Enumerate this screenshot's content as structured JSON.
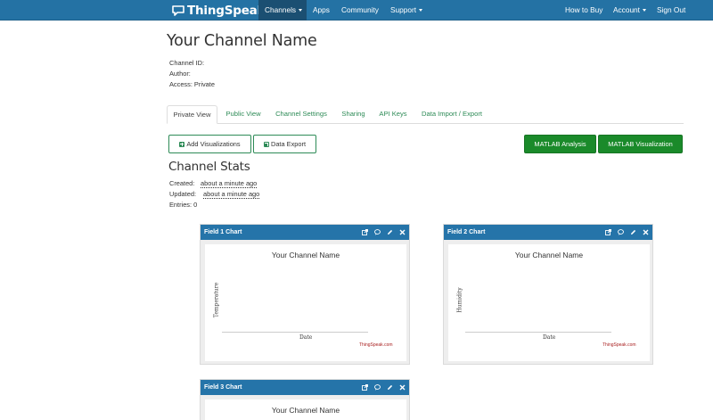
{
  "nav": {
    "brand": "ThingSpeak",
    "brand_tm": "™",
    "items": [
      {
        "label": "Channels",
        "dropdown": true,
        "active": true
      },
      {
        "label": "Apps",
        "dropdown": false
      },
      {
        "label": "Community",
        "dropdown": false
      },
      {
        "label": "Support",
        "dropdown": true
      }
    ],
    "right": [
      {
        "label": "How to Buy",
        "dropdown": false
      },
      {
        "label": "Account",
        "dropdown": true
      },
      {
        "label": "Sign Out",
        "dropdown": false
      }
    ]
  },
  "page": {
    "title": "Your Channel Name",
    "channel_id": "Channel ID:",
    "author": "Author:",
    "access": "Access: Private"
  },
  "tabs": [
    "Private View",
    "Public View",
    "Channel Settings",
    "Sharing",
    "API Keys",
    "Data Import / Export"
  ],
  "buttons": {
    "add_visualizations": "Add Visualizations",
    "data_export": "Data Export",
    "matlab_analysis": "MATLAB Analysis",
    "matlab_visualization": "MATLAB Visualization"
  },
  "stats": {
    "title": "Channel Stats",
    "created_label": "Created:",
    "created_value": "about a minute ago",
    "updated_label": "Updated:",
    "updated_value": "about a minute ago",
    "entries": "Entries: 0"
  },
  "charts": [
    {
      "header": "Field 1 Chart",
      "title": "Your Channel Name",
      "ylabel": "Temperature",
      "xlabel": "Date",
      "credit": "ThingSpeak.com"
    },
    {
      "header": "Field 2 Chart",
      "title": "Your Channel Name",
      "ylabel": "Humidity",
      "xlabel": "Date",
      "credit": "ThingSpeak.com"
    },
    {
      "header": "Field 3 Chart",
      "title": "Your Channel Name"
    }
  ],
  "colors": {
    "navbar": "#2472a4",
    "panel_header": "#2574a9",
    "accent_green": "#1a8a2a",
    "link_green": "#2e8b57"
  }
}
